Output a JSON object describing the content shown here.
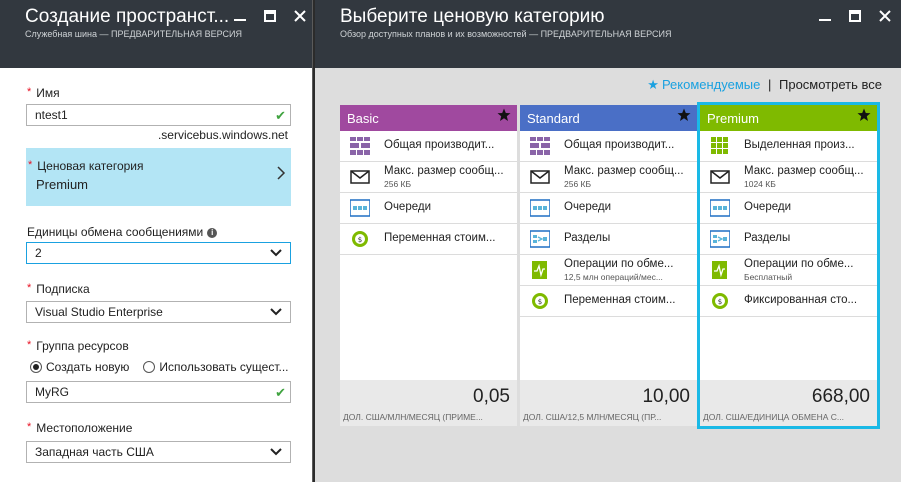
{
  "left_blade": {
    "title": "Создание пространст...",
    "subtitle": "Служебная шина — ПРЕДВАРИТЕЛЬНАЯ ВЕРСИЯ",
    "name_label": "Имя",
    "name_value": "ntest1",
    "name_suffix": ".servicebus.windows.net",
    "pricing_label": "Ценовая категория",
    "pricing_value": "Premium",
    "units_label": "Единицы обмена сообщениями",
    "units_value": "2",
    "subscription_label": "Подписка",
    "subscription_value": "Visual Studio Enterprise",
    "rg_label": "Группа ресурсов",
    "rg_option_new": "Создать новую",
    "rg_option_existing": "Использовать сущест...",
    "rg_value": "MyRG",
    "location_label": "Местоположение",
    "location_value": "Западная часть США"
  },
  "right_blade": {
    "title": "Выберите ценовую категорию",
    "subtitle": "Обзор доступных планов и их возможностей — ПРЕДВАРИТЕЛЬНАЯ ВЕРСИЯ",
    "filter_recommended": "Рекомендуемые",
    "filter_sep": "|",
    "filter_all": "Просмотреть все"
  },
  "cards": [
    {
      "name": "Basic",
      "color": "#a0499f",
      "features": [
        {
          "icon": "shared-capacity-icon",
          "text": "Общая производит...",
          "sub": ""
        },
        {
          "icon": "mail-icon",
          "text": "Макс. размер сообщ...",
          "sub": "256 КБ"
        },
        {
          "icon": "queue-icon",
          "text": "Очереди",
          "sub": ""
        },
        {
          "icon": "coin-icon",
          "text": "Переменная стоим...",
          "sub": ""
        }
      ],
      "price": "0,05",
      "unit": "ДОЛ. США/МЛН/МЕСЯЦ (ПРИМЕ..."
    },
    {
      "name": "Standard",
      "color": "#4a6fc6",
      "features": [
        {
          "icon": "shared-capacity-icon",
          "text": "Общая производит...",
          "sub": ""
        },
        {
          "icon": "mail-icon",
          "text": "Макс. размер сообщ...",
          "sub": "256 КБ"
        },
        {
          "icon": "queue-icon",
          "text": "Очереди",
          "sub": ""
        },
        {
          "icon": "topic-icon",
          "text": "Разделы",
          "sub": ""
        },
        {
          "icon": "activity-icon",
          "text": "Операции по обме...",
          "sub": "12,5 млн операций/мес..."
        },
        {
          "icon": "coin-icon",
          "text": "Переменная стоим...",
          "sub": ""
        }
      ],
      "price": "10,00",
      "unit": "ДОЛ. США/12,5 МЛН/МЕСЯЦ (ПР..."
    },
    {
      "name": "Premium",
      "color": "#7fba00",
      "features": [
        {
          "icon": "dedicated-capacity-icon",
          "text": "Выделенная произ...",
          "sub": ""
        },
        {
          "icon": "mail-icon",
          "text": "Макс. размер сообщ...",
          "sub": "1024 КБ"
        },
        {
          "icon": "queue-icon",
          "text": "Очереди",
          "sub": ""
        },
        {
          "icon": "topic-icon",
          "text": "Разделы",
          "sub": ""
        },
        {
          "icon": "activity-icon",
          "text": "Операции по обме...",
          "sub": "Бесплатный"
        },
        {
          "icon": "coin-icon",
          "text": "Фиксированная сто...",
          "sub": ""
        }
      ],
      "price": "668,00",
      "unit": "ДОЛ. США/ЕДИНИЦА ОБМЕНА С..."
    }
  ]
}
